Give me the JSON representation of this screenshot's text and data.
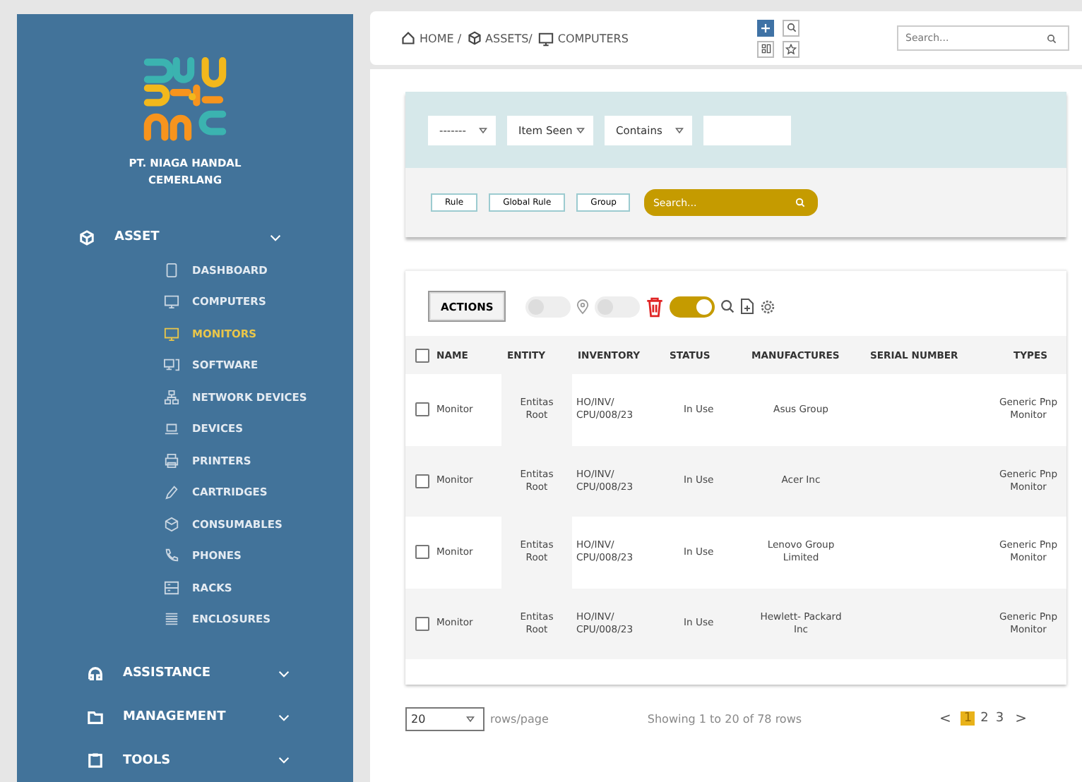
{
  "sidebar": {
    "company": "PT. NIAGA HANDAL CEMERLANG",
    "sections": [
      {
        "label": "ASSET",
        "children": [
          {
            "label": "DASHBOARD",
            "selected": false
          },
          {
            "label": "COMPUTERS",
            "selected": false
          },
          {
            "label": "MONITORS",
            "selected": true
          },
          {
            "label": "SOFTWARE",
            "selected": false
          },
          {
            "label": "NETWORK DEVICES",
            "selected": false
          },
          {
            "label": "DEVICES",
            "selected": false
          },
          {
            "label": "PRINTERS",
            "selected": false
          },
          {
            "label": "CARTRIDGES",
            "selected": false
          },
          {
            "label": "CONSUMABLES",
            "selected": false
          },
          {
            "label": "PHONES",
            "selected": false
          },
          {
            "label": "RACKS",
            "selected": false
          },
          {
            "label": "ENCLOSURES",
            "selected": false
          }
        ]
      },
      {
        "label": "ASSISTANCE"
      },
      {
        "label": "MANAGEMENT"
      },
      {
        "label": "TOOLS"
      }
    ]
  },
  "breadcrumb": [
    "HOME /",
    "ASSETS/",
    "COMPUTERS"
  ],
  "top_search": {
    "placeholder": "Search..."
  },
  "filter": {
    "selects": [
      "-------",
      "Item Seen",
      "Contains"
    ],
    "buttons": [
      "Rule",
      "Global Rule",
      "Group"
    ],
    "search": {
      "placeholder": "Search..."
    }
  },
  "toolbar": {
    "actions": "ACTIONS",
    "toggles": [
      {
        "on": false
      },
      {
        "on": false
      },
      {
        "on": true
      }
    ]
  },
  "table": {
    "columns": [
      "NAME",
      "ENTITY",
      "INVENTORY",
      "STATUS",
      "MANUFACTURES",
      "SERIAL NUMBER",
      "TYPES"
    ],
    "all_checked": false,
    "rows": [
      {
        "checked": false,
        "cells": [
          "Monitor",
          "Entitas Root",
          "HO/INV/ CPU/008/23",
          "In Use",
          "Asus Group",
          "",
          "Generic Pnp Monitor"
        ]
      },
      {
        "checked": false,
        "cells": [
          "Monitor",
          "Entitas Root",
          "HO/INV/ CPU/008/23",
          "In Use",
          "Acer Inc",
          "",
          "Generic Pnp Monitor"
        ]
      },
      {
        "checked": false,
        "cells": [
          "Monitor",
          "Entitas Root",
          "HO/INV/ CPU/008/23",
          "In Use",
          "Lenovo Group Limited",
          "",
          "Generic Pnp Monitor"
        ]
      },
      {
        "checked": false,
        "cells": [
          "Monitor",
          "Entitas Root",
          "HO/INV/ CPU/008/23",
          "In Use",
          "Hewlett- Packard Inc",
          "",
          "Generic Pnp Monitor"
        ]
      }
    ]
  },
  "footer": {
    "page_size": "20",
    "page_size_label": "rows/page",
    "summary": "Showing 1 to 20 of 78 rows",
    "prev": "<",
    "next": ">",
    "pages": [
      {
        "label": "1",
        "selected": true
      },
      {
        "label": "2",
        "selected": false
      },
      {
        "label": "3",
        "selected": false
      }
    ]
  }
}
